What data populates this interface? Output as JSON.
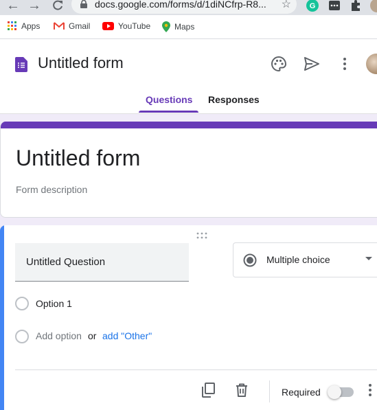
{
  "browser": {
    "url": "docs.google.com/forms/d/1diNCfrp-R8...",
    "bookmarks": [
      {
        "label": "Apps",
        "icon": "apps-grid-icon"
      },
      {
        "label": "Gmail",
        "icon": "gmail-icon"
      },
      {
        "label": "YouTube",
        "icon": "youtube-icon"
      },
      {
        "label": "Maps",
        "icon": "maps-pin-icon"
      }
    ]
  },
  "header": {
    "title": "Untitled form",
    "tabs": [
      {
        "label": "Questions",
        "active": true
      },
      {
        "label": "Responses",
        "active": false
      }
    ]
  },
  "title_card": {
    "title": "Untitled form",
    "description_placeholder": "Form description"
  },
  "question": {
    "title": "Untitled Question",
    "type": "Multiple choice",
    "options": [
      "Option 1"
    ],
    "add_option": "Add option",
    "or_text": "or",
    "add_other": "add \"Other\"",
    "required_label": "Required",
    "required": false
  },
  "colors": {
    "accent": "#673ab7",
    "focus": "#4285f4",
    "link": "#1a73e8"
  }
}
